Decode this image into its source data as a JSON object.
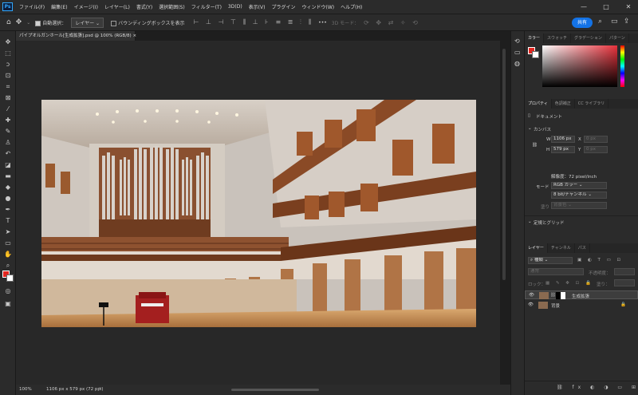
{
  "menubar": {
    "items": [
      "ファイル(F)",
      "編集(E)",
      "イメージ(I)",
      "レイヤー(L)",
      "書式(Y)",
      "選択範囲(S)",
      "フィルター(T)",
      "3D(D)",
      "表示(V)",
      "プラグイン",
      "ウィンドウ(W)",
      "ヘルプ(H)"
    ],
    "window_controls": [
      "—",
      "□",
      "✕"
    ]
  },
  "options": {
    "auto_select_label": "自動選択：",
    "auto_select_value": "レイヤー",
    "bounding_box_label": "バウンディングボックスを表示",
    "mode_3d": "3D モード：",
    "more": "•••",
    "share_label": "共有"
  },
  "document": {
    "tab_title": "パイプオルガンホール[生成拡張].psd @ 100% (RGB/8)",
    "zoom": "100%",
    "info": "1106 px x 579 px (72 ppi)"
  },
  "color_panel": {
    "tabs": [
      "カラー",
      "スウォッチ",
      "グラデーション",
      "パターン"
    ],
    "foreground": "#e3261f",
    "background": "#ffffff",
    "hue_color": "#e8323c"
  },
  "properties": {
    "tabs": [
      "プロパティ",
      "色調補正",
      "CC ライブラリ"
    ],
    "kind": "ドキュメント",
    "canvas_heading": "カンバス",
    "w_label": "W",
    "w_value": "1106 px",
    "h_label": "H",
    "h_value": "579 px",
    "x_label": "X",
    "x_value": "0 px",
    "y_label": "Y",
    "y_value": "0 px",
    "resolution": "解像度：72 pixel/inch",
    "mode_label": "モード",
    "mode_value": "RGB カラー",
    "bit_value": "8 bit/チャンネル",
    "fill_label": "塗り",
    "fill_value": "背景色",
    "guides_heading": "定規とグリッド"
  },
  "layers": {
    "tabs": [
      "レイヤー",
      "チャンネル",
      "パス"
    ],
    "filter_label": "種類",
    "blend_label": "通常",
    "opacity_label": "不透明度：",
    "lock_label": "ロック：",
    "fill_label": "塗り：",
    "items": [
      {
        "name": "生成拡張"
      },
      {
        "name": "背景"
      }
    ]
  },
  "tools": {
    "icons": [
      "move-icon",
      "marquee-icon",
      "lasso-icon",
      "object-select-icon",
      "crop-icon",
      "frame-icon",
      "eyedropper-icon",
      "healing-icon",
      "brush-icon",
      "stamp-icon",
      "history-brush-icon",
      "eraser-icon",
      "gradient-icon",
      "blur-icon",
      "dodge-icon",
      "pen-icon",
      "type-icon",
      "path-select-icon",
      "rectangle-icon",
      "hand-icon",
      "zoom-icon"
    ]
  }
}
